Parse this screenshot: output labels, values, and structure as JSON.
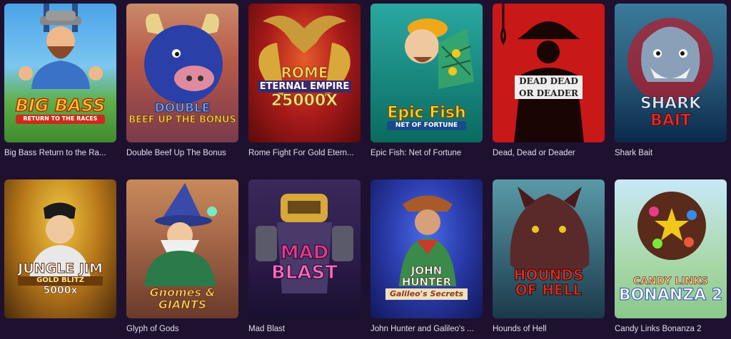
{
  "tiles": [
    {
      "caption": "Big Bass Return to the Ra...",
      "logo": [
        "BIG BASS",
        "RETURN TO THE RACES"
      ]
    },
    {
      "caption": "Double Beef Up The Bonus",
      "logo": [
        "DOUBLE",
        "BEEF UP THE BONUS"
      ]
    },
    {
      "caption": "Rome Fight For Gold Etern...",
      "logo": [
        "ROME",
        "ETERNAL EMPIRE",
        "25000X"
      ]
    },
    {
      "caption": "Epic Fish: Net of Fortune",
      "logo": [
        "Epic Fish",
        "NET OF FORTUNE"
      ]
    },
    {
      "caption": "Dead, Dead or Deader",
      "logo": [
        "DEAD DEAD",
        "OR DEADER"
      ]
    },
    {
      "caption": "Shark Bait",
      "logo": [
        "SHARK",
        "BAIT"
      ]
    },
    {
      "caption": "",
      "logo": [
        "JUNGLE JIM",
        "GOLD BLITZ",
        "5000x"
      ]
    },
    {
      "caption": "Glyph of Gods",
      "logo": [
        "Gnomes & GIANTS"
      ]
    },
    {
      "caption": "Mad Blast",
      "logo": [
        "MAD",
        "BLAST"
      ]
    },
    {
      "caption": "John Hunter and Galileo's ...",
      "logo": [
        "JOHN",
        "HUNTER",
        "Galileo's Secrets"
      ]
    },
    {
      "caption": "Hounds of Hell",
      "logo": [
        "HOUNDS",
        "OF HELL"
      ]
    },
    {
      "caption": "Candy Links Bonanza 2",
      "logo": [
        "CANDY LINKS",
        "BONANZA 2"
      ]
    }
  ]
}
